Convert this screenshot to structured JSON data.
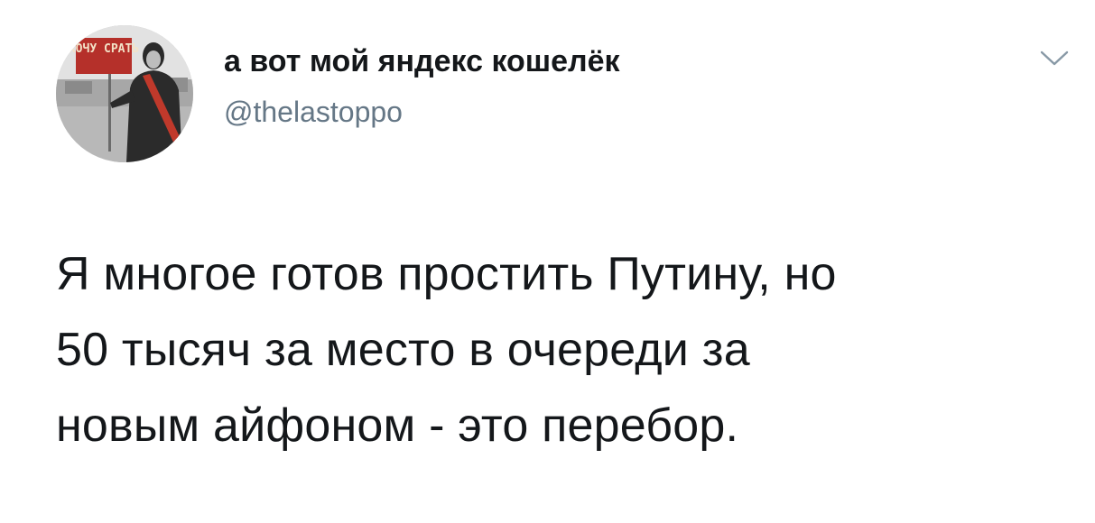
{
  "tweet": {
    "author": {
      "display_name": "а вот мой яндекс кошелёк",
      "handle": "@thelastoppo",
      "avatar_sign_text": "ХОЧУ СРАТЬ"
    },
    "menu_icon": "chevron-down-icon",
    "text": "Я многое готов простить Путину, но\n50 тысяч за место в очереди за\nновым айфоном - это перебор."
  },
  "colors": {
    "primary_text": "#14171a",
    "secondary_text": "#657786",
    "caret": "#8899a6",
    "background": "#ffffff",
    "sign_red": "#b5302a"
  }
}
